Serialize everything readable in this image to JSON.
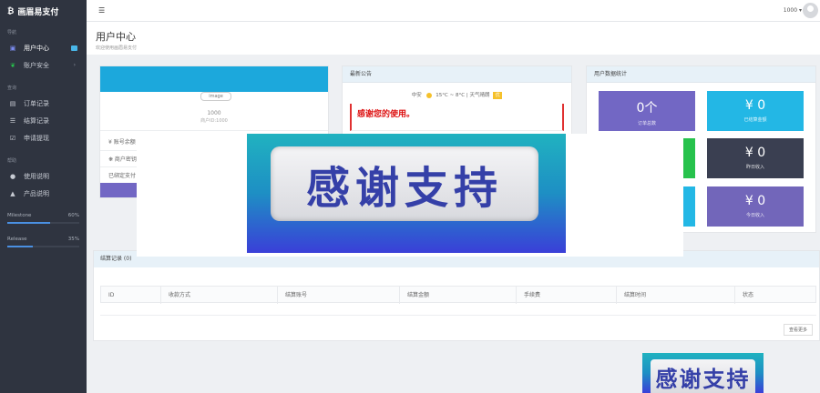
{
  "brand": {
    "name": "画眉易支付"
  },
  "sidebar": {
    "section_main": "导航",
    "items_main": [
      {
        "label": "用户中心",
        "icon": "user-icon"
      },
      {
        "label": "账户安全",
        "icon": "leaf-icon"
      }
    ],
    "section_query": "查询",
    "items_query": [
      {
        "label": "订单记录",
        "icon": "order-icon"
      },
      {
        "label": "结算记录",
        "icon": "list-icon"
      },
      {
        "label": "申请提现",
        "icon": "check-icon"
      }
    ],
    "section_help": "帮助",
    "items_help": [
      {
        "label": "使用说明",
        "icon": "info-icon"
      },
      {
        "label": "产品说明",
        "icon": "bell-icon"
      }
    ],
    "progress": [
      {
        "label": "Milestone",
        "value": "60%",
        "fraction": 0.6
      },
      {
        "label": "Release",
        "value": "35%",
        "fraction": 0.35
      }
    ]
  },
  "topbar": {
    "user": "1000"
  },
  "page": {
    "title": "用户中心",
    "subtitle": "欢迎使用画眉易支付"
  },
  "profile": {
    "image_alt": "image",
    "merchant_id": "1000",
    "sub": "商户ID:1000",
    "row1": "¥ 账号余额",
    "row2": "❋ 商户密钥",
    "row3": "已绑定支付",
    "button": "查看"
  },
  "notice": {
    "title": "最新公告",
    "weather_city": "中安",
    "weather_temp": "15°C ~ 8°C",
    "weather_desc": "天气晴朗",
    "weather_badge": "优",
    "message": "感谢您的使用。"
  },
  "stats": {
    "title": "用户数据统计",
    "tiles": [
      {
        "value": "0个",
        "label": "订单总数",
        "color": "#7267c4"
      },
      {
        "value": "¥ 0",
        "label": "已结算金额",
        "color": "#23b7e5"
      },
      {
        "value": "¥ 0",
        "label": "昨日收入",
        "color": "#3a3f51"
      },
      {
        "value": "¥ 0",
        "label": "今日收入",
        "color": "#7266ba"
      }
    ],
    "accent_green": "#27c24c"
  },
  "settle": {
    "title": "结算记录 (0)",
    "columns": [
      "ID",
      "收款方式",
      "结算账号",
      "结算金额",
      "手续费",
      "结算时间",
      "状态"
    ],
    "more": "查看更多"
  },
  "banner": {
    "text": "感谢支持",
    "small_text": "感谢支持"
  }
}
